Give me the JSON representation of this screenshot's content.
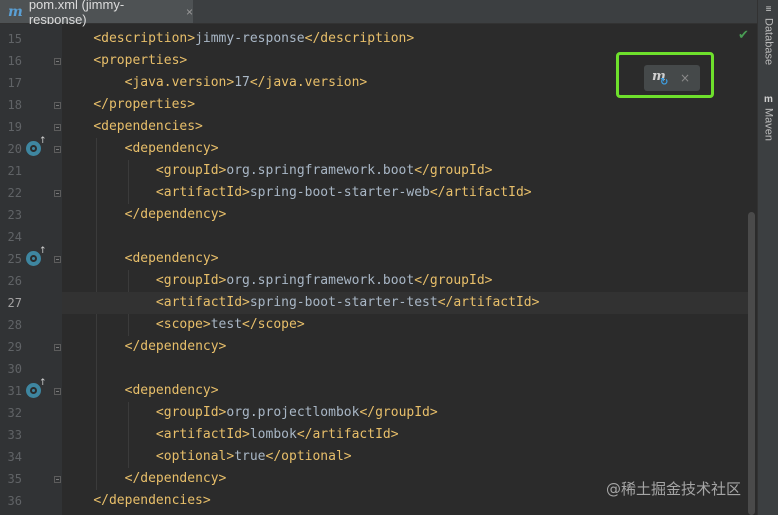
{
  "tab": {
    "icon": "m",
    "title": "pom.xml (jimmy-response)",
    "close": "×"
  },
  "gutter": {
    "line_numbers": [
      "15",
      "16",
      "17",
      "18",
      "19",
      "20",
      "21",
      "22",
      "23",
      "24",
      "25",
      "26",
      "27",
      "28",
      "29",
      "30",
      "31",
      "32",
      "33",
      "34",
      "35",
      "36"
    ],
    "current_line": "27"
  },
  "code_lines": [
    {
      "indent": "    ",
      "parts": [
        [
          "tag",
          "<description>"
        ],
        [
          "txt",
          "jimmy-response"
        ],
        [
          "tag",
          "</description>"
        ]
      ]
    },
    {
      "indent": "    ",
      "parts": [
        [
          "tag",
          "<properties>"
        ]
      ]
    },
    {
      "indent": "        ",
      "parts": [
        [
          "tag",
          "<java.version>"
        ],
        [
          "txt",
          "17"
        ],
        [
          "tag",
          "</java.version>"
        ]
      ]
    },
    {
      "indent": "    ",
      "parts": [
        [
          "tag",
          "</properties>"
        ]
      ]
    },
    {
      "indent": "    ",
      "parts": [
        [
          "tag",
          "<dependencies>"
        ]
      ]
    },
    {
      "indent": "        ",
      "parts": [
        [
          "tag",
          "<dependency>"
        ]
      ]
    },
    {
      "indent": "            ",
      "parts": [
        [
          "tag",
          "<groupId>"
        ],
        [
          "txt",
          "org.springframework.boot"
        ],
        [
          "tag",
          "</groupId>"
        ]
      ]
    },
    {
      "indent": "            ",
      "parts": [
        [
          "tag",
          "<artifactId>"
        ],
        [
          "txt",
          "spring-boot-starter-web"
        ],
        [
          "tag",
          "</artifactId>"
        ]
      ]
    },
    {
      "indent": "        ",
      "parts": [
        [
          "tag",
          "</dependency>"
        ]
      ]
    },
    {
      "indent": "",
      "parts": []
    },
    {
      "indent": "        ",
      "parts": [
        [
          "tag",
          "<dependency>"
        ]
      ]
    },
    {
      "indent": "            ",
      "parts": [
        [
          "tag",
          "<groupId>"
        ],
        [
          "txt",
          "org.springframework.boot"
        ],
        [
          "tag",
          "</groupId>"
        ]
      ]
    },
    {
      "indent": "            ",
      "parts": [
        [
          "tag",
          "<artifactId>"
        ],
        [
          "txt",
          "spring-boot-starter-test"
        ],
        [
          "tag",
          "</artifactId>"
        ]
      ]
    },
    {
      "indent": "            ",
      "parts": [
        [
          "tag",
          "<scope>"
        ],
        [
          "txt",
          "test"
        ],
        [
          "tag",
          "</scope>"
        ]
      ]
    },
    {
      "indent": "        ",
      "parts": [
        [
          "tag",
          "</dependency>"
        ]
      ]
    },
    {
      "indent": "",
      "parts": []
    },
    {
      "indent": "        ",
      "parts": [
        [
          "tag",
          "<dependency>"
        ]
      ]
    },
    {
      "indent": "            ",
      "parts": [
        [
          "tag",
          "<groupId>"
        ],
        [
          "txt",
          "org.projectlombok"
        ],
        [
          "tag",
          "</groupId>"
        ]
      ]
    },
    {
      "indent": "            ",
      "parts": [
        [
          "tag",
          "<artifactId>"
        ],
        [
          "txt",
          "lombok"
        ],
        [
          "tag",
          "</artifactId>"
        ]
      ]
    },
    {
      "indent": "            ",
      "parts": [
        [
          "tag",
          "<optional>"
        ],
        [
          "txt",
          "true"
        ],
        [
          "tag",
          "</optional>"
        ]
      ]
    },
    {
      "indent": "        ",
      "parts": [
        [
          "tag",
          "</dependency>"
        ]
      ]
    },
    {
      "indent": "    ",
      "parts": [
        [
          "tag",
          "</dependencies>"
        ]
      ]
    }
  ],
  "maven_popup": {
    "icon": "maven-reload-icon",
    "close": "×"
  },
  "status": {
    "check": "✔"
  },
  "tool_windows": [
    {
      "label": "Database",
      "icon": "database-icon",
      "glyph": "≡"
    },
    {
      "label": "Maven",
      "icon": "maven-icon",
      "glyph": "m"
    }
  ],
  "watermark": "@稀土掘金技术社区",
  "colors": {
    "tag": "#e8bf6a",
    "text": "#a9b7c6",
    "background": "#2b2b2b",
    "highlight": "#6ee02c"
  }
}
